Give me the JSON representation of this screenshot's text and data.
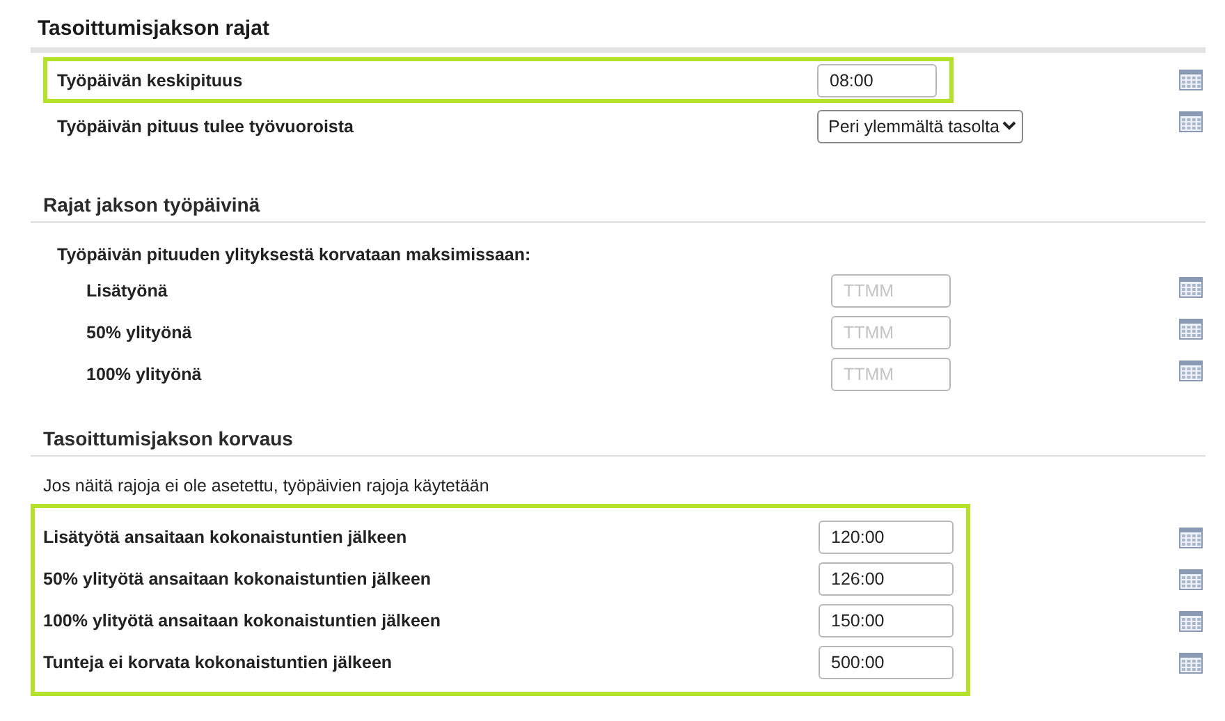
{
  "sections": [
    {
      "kind": "main",
      "title": "Tasoittumisjakson rajat",
      "groups": [
        {
          "highlighted": true,
          "rows": [
            {
              "kind": "input",
              "label": "Työpäivän keskipituus",
              "value": "08:00"
            }
          ]
        },
        {
          "highlighted": false,
          "rows": [
            {
              "kind": "select",
              "label": "Työpäivän pituus tulee työvuoroista",
              "value": "Peri ylemmältä tasolta"
            }
          ]
        }
      ]
    },
    {
      "kind": "sub",
      "title": "Rajat jakson työpäivinä",
      "groups": [
        {
          "highlighted": false,
          "heading": "Työpäivän pituuden ylityksestä korvataan maksimissaan:",
          "rows": [
            {
              "kind": "input",
              "label": "Lisätyönä",
              "placeholder": "TTMM"
            },
            {
              "kind": "input",
              "label": "50% ylityönä",
              "placeholder": "TTMM"
            },
            {
              "kind": "input",
              "label": "100% ylityönä",
              "placeholder": "TTMM"
            }
          ]
        }
      ]
    },
    {
      "kind": "sub",
      "title": "Tasoittumisjakson korvaus",
      "note": "Jos näitä rajoja ei ole asetettu, työpäivien rajoja käytetään",
      "groups": [
        {
          "highlighted": true,
          "rows": [
            {
              "kind": "input",
              "label": "Lisätyötä ansaitaan kokonaistuntien jälkeen",
              "value": "120:00"
            },
            {
              "kind": "input",
              "label": "50% ylityötä ansaitaan kokonaistuntien jälkeen",
              "value": "126:00"
            },
            {
              "kind": "input",
              "label": "100% ylityötä ansaitaan kokonaistuntien jälkeen",
              "value": "150:00"
            },
            {
              "kind": "input",
              "label": "Tunteja ei korvata kokonaistuntien jälkeen",
              "value": "500:00"
            }
          ]
        }
      ]
    }
  ]
}
